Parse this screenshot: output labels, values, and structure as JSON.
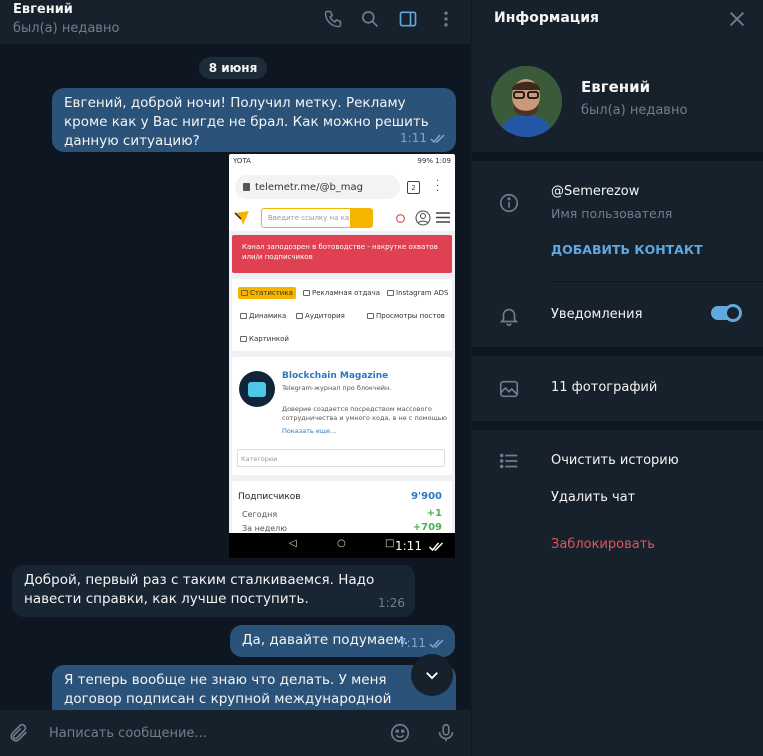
{
  "chat": {
    "title": "Евгений",
    "status": "был(а) недавно",
    "date_separator": "8 июня",
    "messages": [
      {
        "text": "Евгений, доброй ночи! Получил метку. Рекламу кроме как у Вас нигде не брал. Как можно решить данную ситуацию?",
        "time": "1:11"
      },
      {
        "time": "1:11"
      },
      {
        "text": "Доброй, первый раз с таким сталкиваемся. Надо навести справки, как лучше поступить.",
        "time": "1:26"
      },
      {
        "text": "Да, давайте подумаем.",
        "time": "7:11"
      },
      {
        "text": "Я теперь вообще не знаю что делать. У меня договор подписан с крупной международной компанией и могут"
      }
    ],
    "composer_placeholder": "Написать сообщение..."
  },
  "phone": {
    "carrier": "YOTA",
    "status_right": "99% 1:09",
    "url": "telemetr.me/@b_mag",
    "tab_count": "2",
    "search_placeholder": "Введите ссылку на ка",
    "alert": "Канал заподозрен в ботоводстве - накрутке охватов или/и подписчиков",
    "chips": [
      "Статистика",
      "Рекламная отдача",
      "Instagram ADS",
      "Динамика",
      "Аудитория",
      "Просмотры постов",
      "Картинкой"
    ],
    "channel_name": "Blockchain Magazine",
    "channel_desc": "Telegram-журнал про блокчейн.",
    "channel_about": "Доверие создается посредством массового сотрудничества и умного кода, в не с помощью",
    "show_more": "Показать еще...",
    "categories": "Категории",
    "subscribers_label": "Подписчиков",
    "subscribers_value": "9'900",
    "today_label": "Сегодня",
    "today_value": "+1",
    "week_label": "За неделю",
    "week_value": "+709"
  },
  "info": {
    "title": "Информация",
    "name": "Евгений",
    "status": "был(а) недавно",
    "username": "@Semerezow",
    "username_label": "Имя пользователя",
    "add_contact": "ДОБАВИТЬ КОНТАКТ",
    "notifications": "Уведомления",
    "notifications_on": true,
    "photos": "11 фотографий",
    "clear_history": "Очистить историю",
    "delete_chat": "Удалить чат",
    "block": "Заблокировать"
  },
  "colors": {
    "accent": "#5fa8e0",
    "outgoing_bubble": "#2b5278",
    "incoming_bubble": "#182533",
    "danger": "#e0545e"
  }
}
